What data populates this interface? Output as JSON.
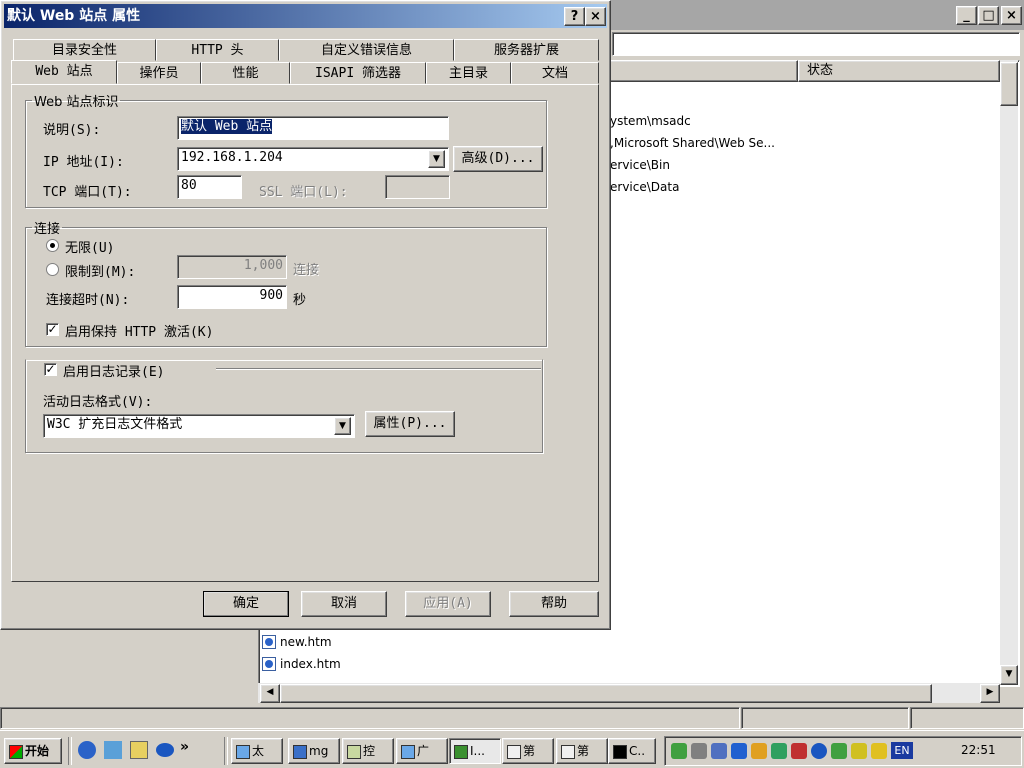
{
  "background_window": {
    "header": {
      "status": "状态"
    },
    "paths": [
      "ystem\\msadc",
      ",Microsoft Shared\\Web Se...",
      "ervice\\Bin",
      "ervice\\Data"
    ],
    "files": [
      "new.htm",
      "index.htm"
    ],
    "controls": {
      "minimize": "_",
      "maximize": "□",
      "close": "×"
    }
  },
  "dialog": {
    "title": "默认 Web 站点 属性",
    "help_glyph": "?",
    "close_glyph": "×",
    "tabs_row1": [
      "目录安全性",
      "HTTP 头",
      "自定义错误信息",
      "服务器扩展"
    ],
    "tabs_row2": [
      "Web 站点",
      "操作员",
      "性能",
      "ISAPI 筛选器",
      "主目录",
      "文档"
    ],
    "identity": {
      "legend": "Web 站点标识",
      "desc_label": "说明(S):",
      "desc_value": "默认 Web 站点",
      "ip_label": "IP 地址(I):",
      "ip_value": "192.168.1.204",
      "advanced_button": "高级(D)...",
      "tcp_label": "TCP 端口(T):",
      "tcp_value": "80",
      "ssl_label": "SSL 端口(L):",
      "ssl_value": ""
    },
    "connections": {
      "legend": "连接",
      "unlimited": "无限(U)",
      "limited": "限制到(M):",
      "limited_value": "1,000",
      "limited_unit": "连接",
      "timeout_label": "连接超时(N):",
      "timeout_value": "900",
      "timeout_unit": "秒",
      "keepalive": "启用保持 HTTP 激活(K)"
    },
    "logging": {
      "enable": "启用日志记录(E)",
      "format_label": "活动日志格式(V):",
      "format_value": "W3C 扩充日志文件格式",
      "properties_button": "属性(P)..."
    },
    "buttons": {
      "ok": "确定",
      "cancel": "取消",
      "apply": "应用(A)",
      "help": "帮助"
    }
  },
  "taskbar": {
    "start": "开始",
    "chevron": "»",
    "items": [
      "太",
      "mg",
      "控",
      "广",
      "I...",
      "第",
      "第",
      "C.."
    ],
    "lang": "EN",
    "clock": "22:51"
  }
}
